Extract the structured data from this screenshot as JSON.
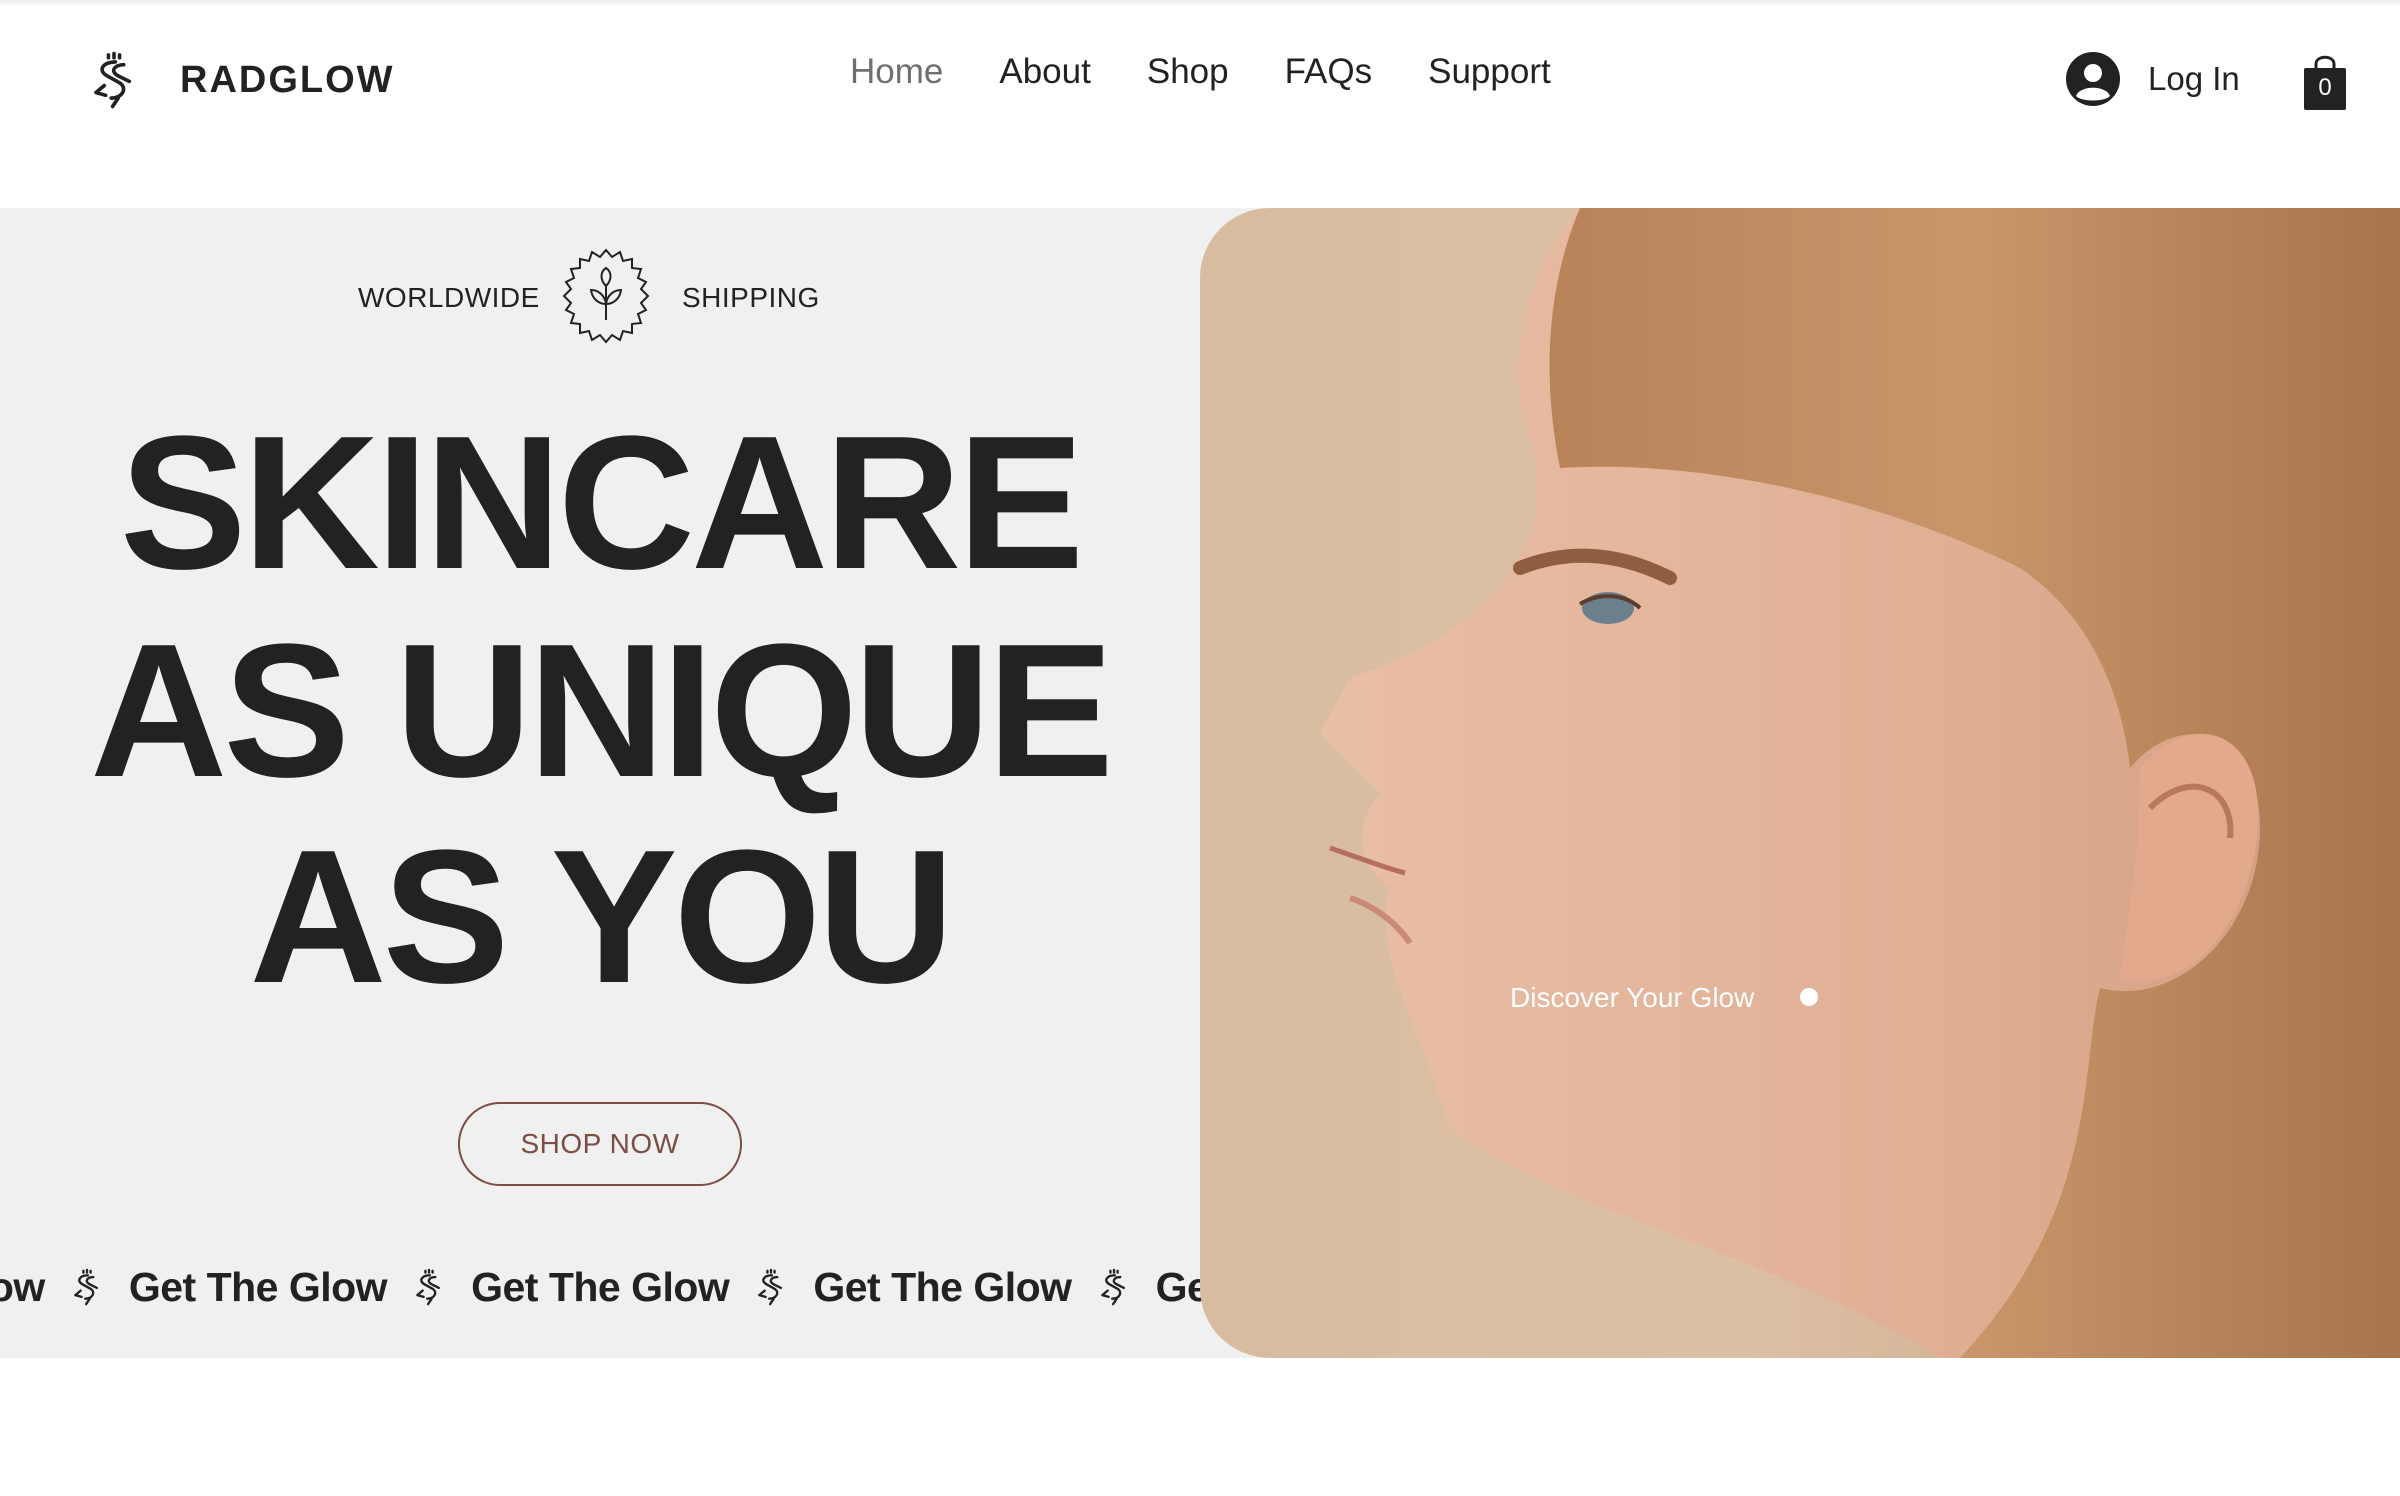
{
  "brand": {
    "name": "RADGLOW",
    "logo_icon": "radglow-logo-icon"
  },
  "nav": {
    "items": [
      {
        "label": "Home",
        "active": true
      },
      {
        "label": "About"
      },
      {
        "label": "Shop"
      },
      {
        "label": "FAQs"
      },
      {
        "label": "Support"
      }
    ]
  },
  "account": {
    "login_label": "Log In",
    "avatar_icon": "user-avatar-icon"
  },
  "cart": {
    "count": "0",
    "icon": "shopping-bag-icon"
  },
  "hero": {
    "shipping_left": "WORLDWIDE",
    "shipping_right": "SHIPPING",
    "badge_icon": "leaf-seal-icon",
    "headline_lines": [
      "SKINCARE",
      "AS UNIQUE",
      "AS YOU"
    ],
    "cta_label": "SHOP NOW",
    "marquee_fragment_start": "low",
    "marquee_text": "Get The Glow",
    "marquee_fragment_end": "Ge",
    "image_caption": "Discover Your Glow"
  },
  "colors": {
    "text": "#222222",
    "nav_active": "#6f6f6f",
    "hero_bg": "#f0f0f0",
    "accent_brown": "#7a4e42",
    "image_bg": "#d8bca0"
  }
}
